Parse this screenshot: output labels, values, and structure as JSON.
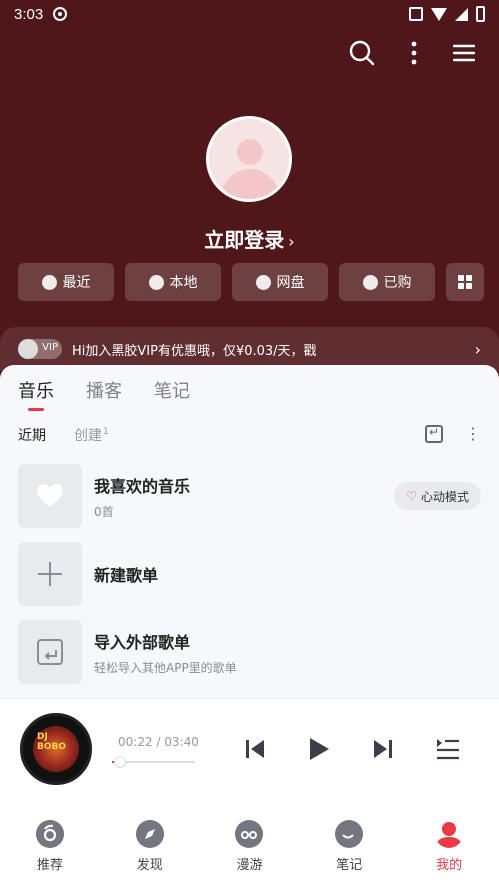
{
  "status_bar": {
    "time": "3:03"
  },
  "profile": {
    "login_label": "立即登录",
    "login_chevron": "›"
  },
  "quick_buttons": [
    {
      "label": "最近",
      "icon": "clock-icon"
    },
    {
      "label": "本地",
      "icon": "download-icon"
    },
    {
      "label": "网盘",
      "icon": "cloud-upload-icon"
    },
    {
      "label": "已购",
      "icon": "bag-icon"
    }
  ],
  "vip_banner": {
    "badge": "VIP",
    "text": "Hi加入黑胶VIP有优惠哦，仅¥0.03/天，戳",
    "arrow": "›"
  },
  "tabs": [
    "音乐",
    "播客",
    "笔记"
  ],
  "subtabs": {
    "recent": "近期",
    "created": "创建",
    "created_count": "1"
  },
  "playlists": [
    {
      "title": "我喜欢的音乐",
      "subtitle": "0首",
      "action": "心动模式",
      "icon": "heart-icon"
    },
    {
      "title": "新建歌单",
      "subtitle": "",
      "icon": "plus-icon"
    },
    {
      "title": "导入外部歌单",
      "subtitle": "轻松导入其他APP里的歌单",
      "icon": "import-icon"
    }
  ],
  "player": {
    "elapsed": "00:22",
    "separator": "/",
    "duration": "03:40",
    "progress": 0.1,
    "cover_text": "DJ BOBO"
  },
  "bottom_nav": [
    {
      "label": "推荐",
      "icon": "netease-icon"
    },
    {
      "label": "发现",
      "icon": "compass-icon"
    },
    {
      "label": "漫游",
      "icon": "infinity-icon"
    },
    {
      "label": "笔记",
      "icon": "note-icon"
    },
    {
      "label": "我的",
      "icon": "user-icon",
      "active": true
    }
  ],
  "colors": {
    "brand_red": "#e83b46",
    "header_bg": "#4f1719"
  }
}
